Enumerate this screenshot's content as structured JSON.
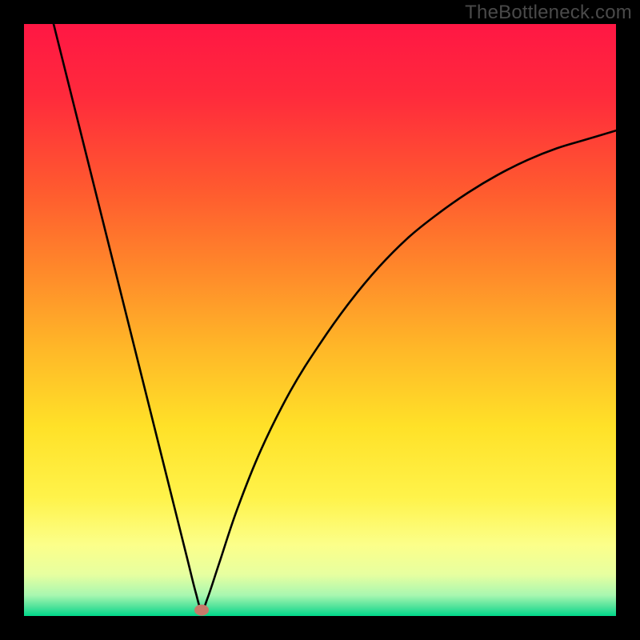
{
  "watermark": "TheBottleneck.com",
  "chart_data": {
    "type": "line",
    "title": "",
    "xlabel": "",
    "ylabel": "",
    "xlim": [
      0,
      100
    ],
    "ylim": [
      0,
      100
    ],
    "series": [
      {
        "name": "curve",
        "x": [
          5,
          7.5,
          10,
          12.5,
          15,
          17.5,
          20,
          22.5,
          25,
          27.5,
          29,
          30,
          31,
          33,
          36,
          40,
          45,
          50,
          55,
          60,
          65,
          70,
          75,
          80,
          85,
          90,
          95,
          100
        ],
        "y": [
          100,
          90,
          80,
          70,
          60,
          50,
          40,
          30,
          20,
          10,
          4,
          1,
          3,
          9,
          18,
          28,
          38,
          46,
          53,
          59,
          64,
          68,
          71.5,
          74.5,
          77,
          79,
          80.5,
          82
        ]
      }
    ],
    "marker": {
      "x": 30,
      "y": 1
    },
    "background_gradient": {
      "stops": [
        {
          "offset": 0.0,
          "color": "#ff1744"
        },
        {
          "offset": 0.12,
          "color": "#ff2a3c"
        },
        {
          "offset": 0.28,
          "color": "#ff5a2f"
        },
        {
          "offset": 0.42,
          "color": "#ff8a2a"
        },
        {
          "offset": 0.55,
          "color": "#ffb828"
        },
        {
          "offset": 0.68,
          "color": "#ffe128"
        },
        {
          "offset": 0.8,
          "color": "#fff34a"
        },
        {
          "offset": 0.88,
          "color": "#fcff8a"
        },
        {
          "offset": 0.93,
          "color": "#e7ffa0"
        },
        {
          "offset": 0.965,
          "color": "#a8f7b0"
        },
        {
          "offset": 0.985,
          "color": "#4de29a"
        },
        {
          "offset": 1.0,
          "color": "#00d88a"
        }
      ]
    }
  }
}
